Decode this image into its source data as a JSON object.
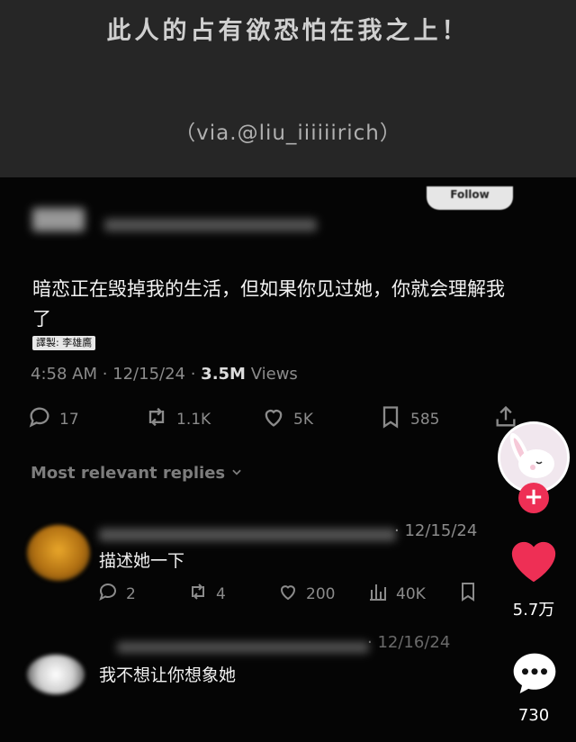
{
  "header": {
    "headline": "此人的占有欲恐怕在我之上！",
    "via": "（via.@liu_iiiiiirich）"
  },
  "tweet": {
    "follow_label": "Follow",
    "text": "暗恋正在毁掉我的生活，但如果你见过她，你就会理解我了",
    "translator": "譯製: 李雄鷹",
    "time": "4:58 AM · 12/15/24 · ",
    "views_count": "3.5M",
    "views_label": " Views",
    "actions": {
      "replies": "17",
      "retweets": "1.1K",
      "likes": "5K",
      "bookmarks": "585"
    },
    "replies_header": "Most relevant replies"
  },
  "replies": [
    {
      "date": "· 12/15/24",
      "text": "描述她一下",
      "actions": {
        "replies": "2",
        "retweets": "4",
        "likes": "200",
        "views": "40K"
      }
    },
    {
      "date": "· 12/16/24",
      "text": "我不想让你想象她"
    }
  ],
  "sidebar": {
    "like_count": "5.7万",
    "comment_count": "730"
  },
  "colors": {
    "accent_red": "#ee2f55",
    "banner_bg": "#262626"
  }
}
